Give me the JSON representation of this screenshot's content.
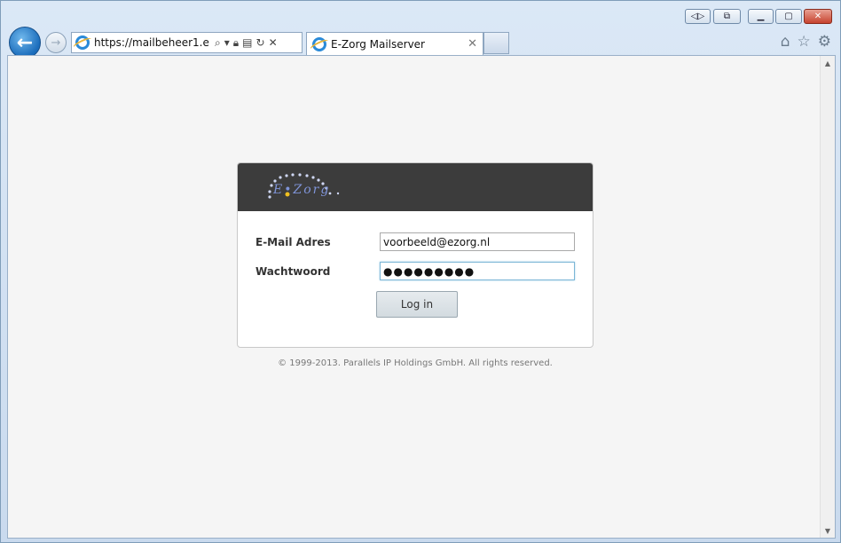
{
  "browser": {
    "url": "https://mailbeheer1.ez...",
    "tab_title": "E-Zorg Mailserver",
    "caption_buttons": [
      "minimize",
      "restore",
      "close"
    ]
  },
  "logo_text": "E•Zorg",
  "form": {
    "email_label": "E-Mail Adres",
    "email_value": "voorbeeld@ezorg.nl",
    "password_label": "Wachtwoord",
    "password_value": "●●●●●●●●●",
    "login_button": "Log in"
  },
  "footer": {
    "copyright": "© 1999-2013. Parallels IP Holdings GmbH. All rights reserved."
  }
}
